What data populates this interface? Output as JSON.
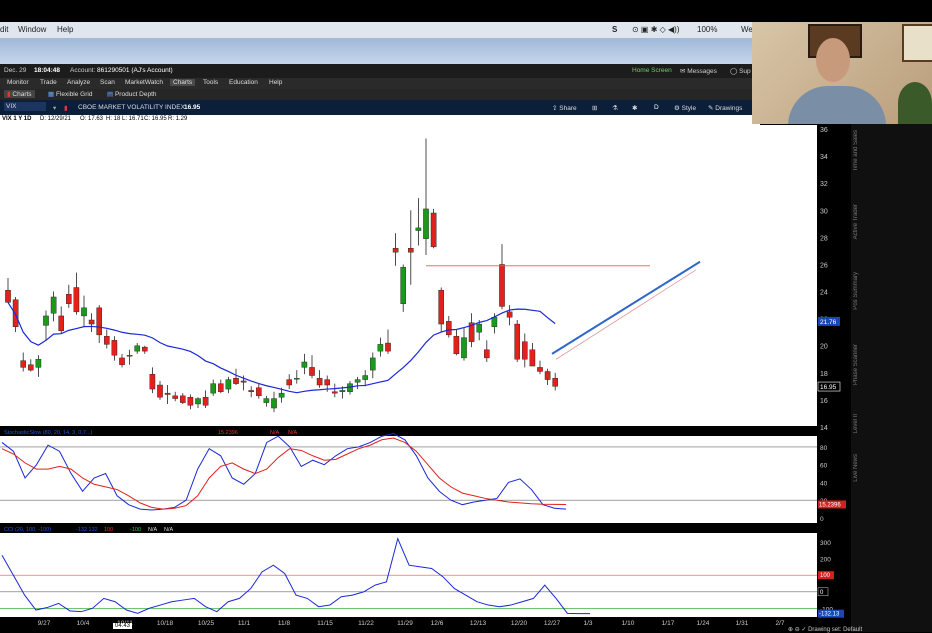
{
  "mac_menu": {
    "edit": "dit",
    "window": "Window",
    "help": "Help",
    "battery": "100%",
    "day": "We"
  },
  "header": {
    "date": "Dec. 29",
    "time": "18:04:48",
    "account_label": "Account:",
    "account": "861290501 (AJ's Account)",
    "home_screen": "Home Screen",
    "messages": "Messages",
    "support": "Sup"
  },
  "tabs": [
    "Monitor",
    "Trade",
    "Analyze",
    "Scan",
    "MarketWatch",
    "Charts",
    "Tools",
    "Education",
    "Help"
  ],
  "active_tab": "Charts",
  "subtabs": {
    "charts": "Charts",
    "flexible_grid": "Flexible Grid",
    "product_depth": "Product Depth"
  },
  "symbol_bar": {
    "symbol": "VIX",
    "name": "CBOE MARKET VOLATILITY INDEX",
    "price": "16.95",
    "share": "Share",
    "period": "D",
    "style": "Style",
    "drawings": "Drawings"
  },
  "info_bar": {
    "title": "VIX 1 Y 1D",
    "date": "D: 12/29/21",
    "open": "O: 17.63",
    "high": "H: 18",
    "low": "L: 16.71",
    "close": "C: 16.95",
    "range": "R: 1.29"
  },
  "price_axis": {
    "labels": [
      "36",
      "34",
      "32",
      "30",
      "28",
      "26",
      "24",
      "22",
      "20",
      "18",
      "16",
      "14"
    ],
    "ma_tag": "21.76",
    "price_tag": "16.95"
  },
  "x_axis": {
    "labels": [
      "9/27",
      "10/4",
      "10/11",
      "10/18",
      "10/25",
      "11/1",
      "11/8",
      "11/15",
      "11/22",
      "11/29",
      "12/6",
      "12/13",
      "12/20",
      "12/27",
      "1/3",
      "1/10",
      "1/17",
      "1/24",
      "1/31",
      "2/7"
    ]
  },
  "stoch": {
    "legend": "StochasticSlow (80, 20, 14, 3, 0,7...)",
    "value": "15.2396",
    "na1": "N/A",
    "na2": "N/A",
    "axis": [
      "80",
      "60",
      "40",
      "20",
      "0"
    ],
    "tag": "15.2396"
  },
  "cci": {
    "legend": "CCI (20, 100, -100)",
    "value": "-132.132",
    "l1": "100",
    "l2": "-100",
    "na1": "N/A",
    "na2": "N/A",
    "axis": [
      "300",
      "200",
      "100",
      "0",
      "-100"
    ],
    "tag100": "100",
    "tag0": "0",
    "tag": "-132.13"
  },
  "colors": {
    "up": "#1a9a1a",
    "down": "#e0211c",
    "ma": "#1a28d8",
    "trend": "#2f67c8",
    "stoch_k": "#1a28d8",
    "stoch_d": "#e0211c"
  },
  "candles": [
    [
      24.1,
      25.0,
      23.2,
      23.2
    ],
    [
      23.4,
      23.6,
      21.0,
      21.4
    ],
    [
      18.9,
      19.5,
      18.1,
      18.4
    ],
    [
      18.6,
      19.0,
      18.1,
      18.2
    ],
    [
      18.4,
      19.3,
      17.7,
      19.0
    ],
    [
      21.5,
      22.6,
      20.4,
      22.2
    ],
    [
      22.4,
      24.0,
      21.8,
      23.6
    ],
    [
      22.2,
      22.9,
      20.9,
      21.1
    ],
    [
      23.8,
      24.5,
      22.8,
      23.1
    ],
    [
      24.3,
      25.4,
      22.3,
      22.5
    ],
    [
      22.2,
      23.7,
      21.4,
      22.8
    ],
    [
      21.9,
      22.4,
      21.0,
      21.6
    ],
    [
      22.8,
      23.0,
      20.2,
      20.8
    ],
    [
      20.7,
      21.2,
      19.8,
      20.1
    ],
    [
      20.4,
      20.7,
      18.9,
      19.3
    ],
    [
      19.1,
      19.4,
      18.4,
      18.6
    ],
    [
      19.3,
      19.7,
      18.6,
      19.3
    ],
    [
      19.6,
      20.2,
      19.4,
      20.0
    ],
    [
      19.9,
      20.0,
      19.4,
      19.6
    ],
    [
      17.9,
      18.4,
      16.5,
      16.8
    ],
    [
      17.1,
      17.4,
      16.0,
      16.2
    ],
    [
      16.5,
      17.1,
      15.7,
      16.4
    ],
    [
      16.3,
      16.6,
      15.9,
      16.1
    ],
    [
      16.3,
      16.5,
      15.7,
      15.8
    ],
    [
      16.2,
      16.4,
      15.3,
      15.6
    ],
    [
      15.7,
      16.2,
      15.4,
      16.1
    ],
    [
      16.2,
      16.7,
      15.4,
      15.6
    ],
    [
      16.5,
      17.5,
      16.3,
      17.2
    ],
    [
      17.2,
      17.5,
      16.5,
      16.6
    ],
    [
      16.8,
      17.7,
      16.5,
      17.5
    ],
    [
      17.6,
      18.3,
      17.1,
      17.2
    ],
    [
      17.4,
      17.8,
      16.7,
      17.3
    ],
    [
      16.7,
      17.0,
      16.2,
      16.6
    ],
    [
      16.9,
      17.2,
      16.1,
      16.3
    ],
    [
      15.8,
      16.3,
      15.5,
      16.1
    ],
    [
      15.4,
      16.6,
      15.1,
      16.1
    ],
    [
      16.2,
      16.9,
      15.8,
      16.5
    ],
    [
      17.5,
      17.9,
      16.8,
      17.1
    ],
    [
      17.6,
      18.2,
      17.2,
      17.6
    ],
    [
      18.4,
      19.4,
      17.9,
      18.8
    ],
    [
      18.4,
      19.3,
      17.6,
      17.8
    ],
    [
      17.6,
      18.2,
      16.9,
      17.1
    ],
    [
      17.5,
      17.8,
      16.6,
      17.1
    ],
    [
      16.6,
      17.2,
      16.2,
      16.5
    ],
    [
      16.6,
      17.0,
      16.1,
      16.7
    ],
    [
      16.6,
      17.4,
      16.4,
      17.2
    ],
    [
      17.3,
      17.7,
      16.8,
      17.5
    ],
    [
      17.5,
      18.2,
      17.0,
      17.8
    ],
    [
      18.2,
      19.5,
      17.6,
      19.1
    ],
    [
      19.6,
      20.6,
      19.2,
      20.1
    ],
    [
      20.2,
      21.2,
      19.4,
      19.6
    ],
    [
      27.2,
      28.3,
      25.9,
      26.9
    ],
    [
      23.1,
      26.0,
      22.5,
      25.8
    ],
    [
      27.2,
      30.0,
      24.5,
      26.9
    ],
    [
      28.5,
      30.9,
      27.4,
      28.7
    ],
    [
      27.9,
      35.3,
      26.7,
      30.1
    ],
    [
      29.8,
      30.1,
      27.2,
      27.3
    ],
    [
      24.1,
      24.3,
      21.0,
      21.6
    ],
    [
      21.8,
      22.2,
      20.6,
      20.8
    ],
    [
      20.7,
      21.2,
      19.3,
      19.4
    ],
    [
      19.1,
      21.3,
      18.9,
      20.6
    ],
    [
      21.7,
      22.4,
      19.9,
      20.3
    ],
    [
      21.0,
      21.9,
      20.4,
      21.6
    ],
    [
      19.7,
      20.4,
      18.8,
      19.1
    ],
    [
      21.4,
      22.4,
      20.9,
      22.1
    ],
    [
      26.0,
      27.5,
      22.7,
      22.9
    ],
    [
      22.5,
      23.0,
      21.5,
      22.1
    ],
    [
      21.6,
      21.9,
      18.8,
      19.0
    ],
    [
      20.3,
      20.9,
      18.4,
      19.0
    ],
    [
      19.7,
      20.2,
      18.5,
      18.5
    ],
    [
      18.4,
      18.9,
      17.9,
      18.1
    ],
    [
      18.1,
      18.3,
      17.1,
      17.5
    ],
    [
      17.6,
      18.0,
      16.7,
      17.0
    ]
  ]
}
